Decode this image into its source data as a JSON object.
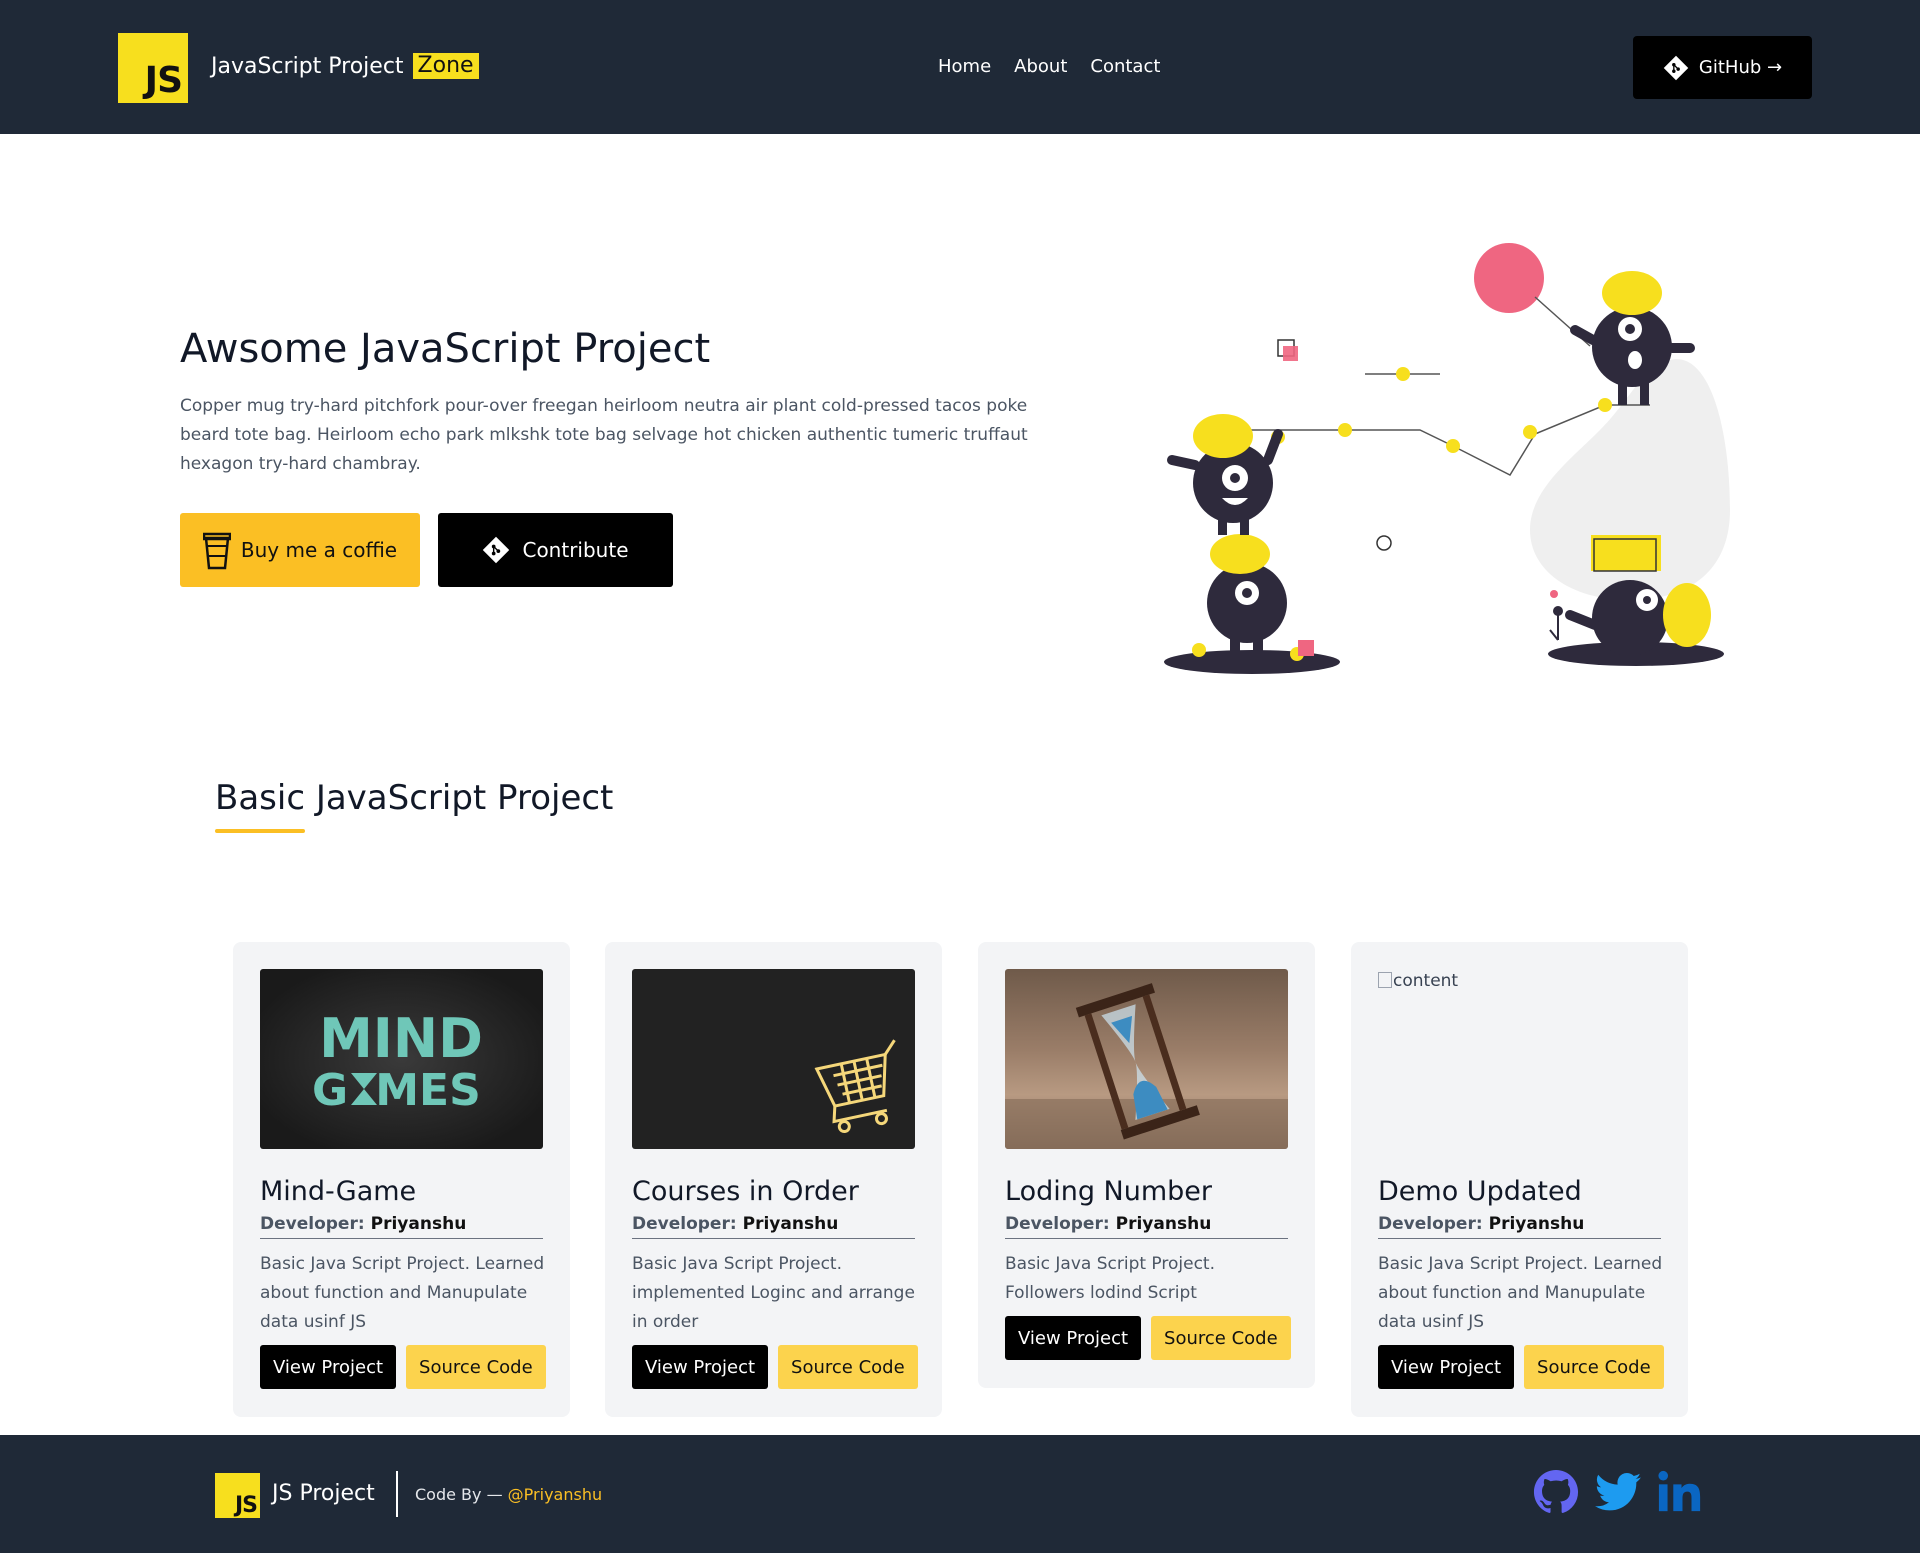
{
  "header": {
    "logo_text": "JS",
    "brand": "JavaScript Project",
    "brand_badge": "Zone",
    "nav": [
      "Home",
      "About",
      "Contact"
    ],
    "github_label": "GitHub →"
  },
  "hero": {
    "title": "Awsome JavaScript Project",
    "text": "Copper mug try-hard pitchfork pour-over freegan heirloom neutra air plant cold-pressed tacos poke beard tote bag. Heirloom echo park mlkshk tote bag selvage hot chicken authentic tumeric truffaut hexagon try-hard chambray.",
    "coffee_label": "Buy me a coffie",
    "contribute_label": "Contribute"
  },
  "section": {
    "title": "Basic JavaScript Project"
  },
  "cards": [
    {
      "title": "Mind-Game",
      "developer_label": "Developer:",
      "developer": "Priyanshu",
      "description": "Basic Java Script Project. Learned about function and Manupulate data usinf JS",
      "view_label": "View Project",
      "source_label": "Source Code",
      "thumb_text_1": "MIND",
      "thumb_text_2": "G",
      "thumb_text_3": "MES"
    },
    {
      "title": "Courses in Order",
      "developer_label": "Developer:",
      "developer": "Priyanshu",
      "description": "Basic Java Script Project. implemented Loginc and arrange in order",
      "view_label": "View Project",
      "source_label": "Source Code"
    },
    {
      "title": "Loding Number",
      "developer_label": "Developer:",
      "developer": "Priyanshu",
      "description": "Basic Java Script Project. Followers lodind Script",
      "view_label": "View Project",
      "source_label": "Source Code"
    },
    {
      "title": "Demo Updated",
      "developer_label": "Developer:",
      "developer": "Priyanshu",
      "description": "Basic Java Script Project. Learned about function and Manupulate data usinf JS",
      "view_label": "View Project",
      "source_label": "Source Code",
      "image_alt": "content"
    }
  ],
  "footer": {
    "logo_text": "JS",
    "brand": "JS Project",
    "code_by": "Code By —",
    "handle": "@Priyanshu",
    "socials": [
      "github-icon",
      "twitter-icon",
      "linkedin-icon"
    ]
  },
  "colors": {
    "header_bg": "#1f2937",
    "js_yellow": "#f7df1e",
    "accent_yellow": "#fbbf24",
    "card_bg": "#f3f4f6",
    "twitter": "#1d9bf0",
    "linkedin": "#0a66c2",
    "github_footer": "#6366f1"
  }
}
